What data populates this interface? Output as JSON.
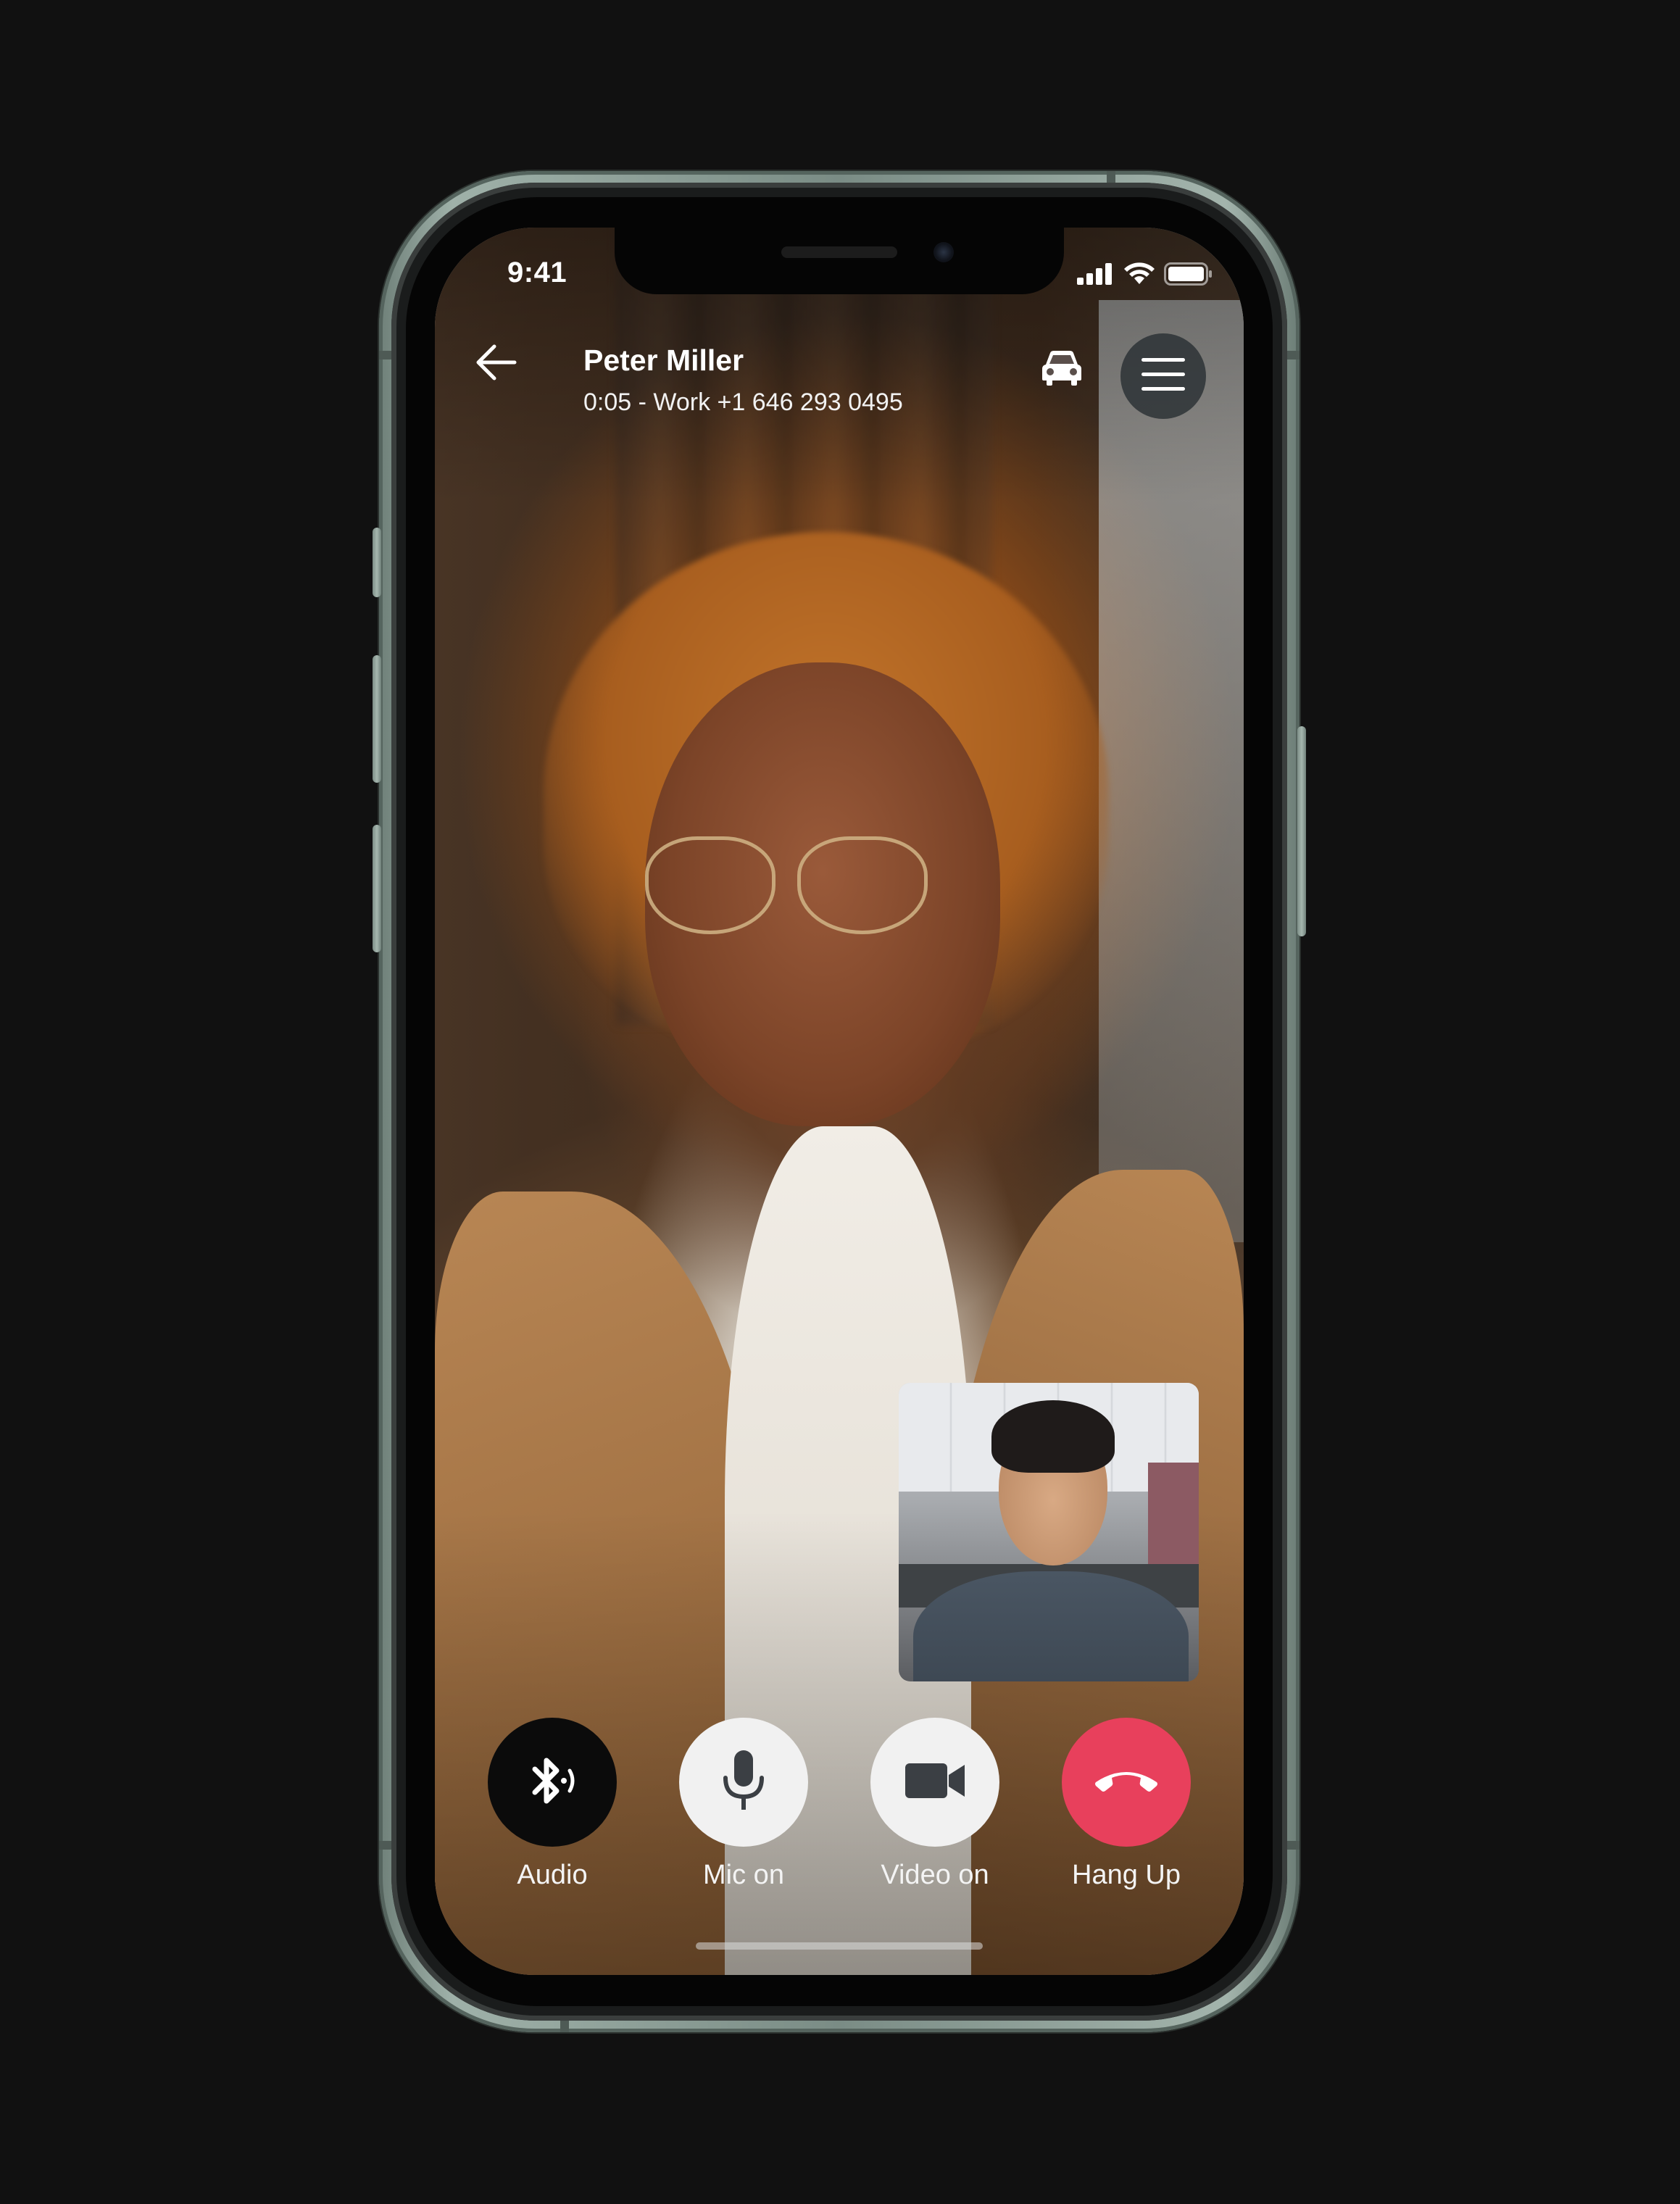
{
  "status_bar": {
    "time": "9:41"
  },
  "header": {
    "caller_name": "Peter Miller",
    "call_details": "0:05 - Work +1 646 293 0495"
  },
  "controls": {
    "audio_label": "Audio",
    "mic_label": "Mic on",
    "video_label": "Video on",
    "hangup_label": "Hang Up"
  },
  "icons": {
    "back": "arrow-left-icon",
    "driving_mode": "car-icon",
    "menu": "hamburger-menu-icon",
    "audio": "bluetooth-audio-icon",
    "mic": "microphone-icon",
    "video": "video-camera-icon",
    "hangup": "phone-hangup-icon"
  },
  "colors": {
    "hangup": "#e8405c",
    "audio_button": "#0b0b0b",
    "toggle_button": "#f1f1f1",
    "menu_button": "#2d3236",
    "text": "#ffffff"
  }
}
